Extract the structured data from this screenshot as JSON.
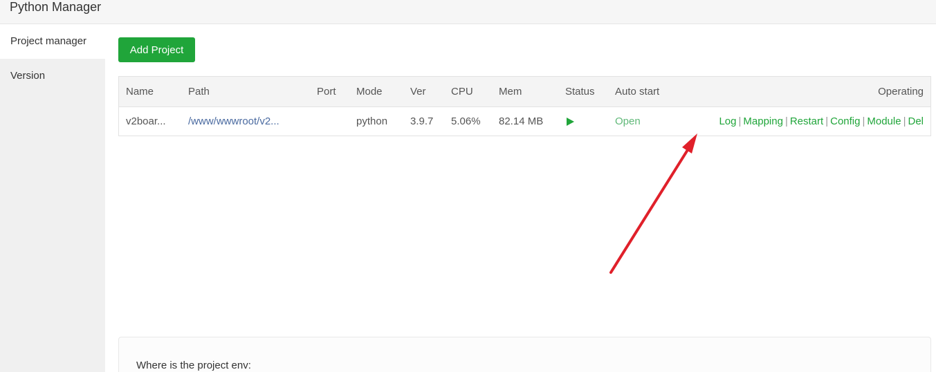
{
  "window": {
    "title": "Python Manager"
  },
  "sidebar": {
    "items": [
      {
        "label": "Project manager",
        "active": true
      },
      {
        "label": "Version",
        "active": false
      }
    ]
  },
  "toolbar": {
    "add_label": "Add Project"
  },
  "table": {
    "headers": {
      "name": "Name",
      "path": "Path",
      "port": "Port",
      "mode": "Mode",
      "ver": "Ver",
      "cpu": "CPU",
      "mem": "Mem",
      "status": "Status",
      "autostart": "Auto start",
      "operating": "Operating"
    },
    "rows": [
      {
        "name": "v2boar...",
        "path": "/www/wwwroot/v2...",
        "port": "",
        "mode": "python",
        "ver": "3.9.7",
        "cpu": "5.06%",
        "mem": "82.14 MB",
        "status_icon": "play-icon",
        "autostart": "Open",
        "ops": {
          "log": "Log",
          "mapping": "Mapping",
          "restart": "Restart",
          "config": "Config",
          "module": "Module",
          "del": "Del"
        }
      }
    ]
  },
  "info": {
    "text": "Where is the project env:"
  },
  "colors": {
    "accent": "#20a53a",
    "annotation_arrow": "#e0202a",
    "link": "#4a6aa0"
  }
}
